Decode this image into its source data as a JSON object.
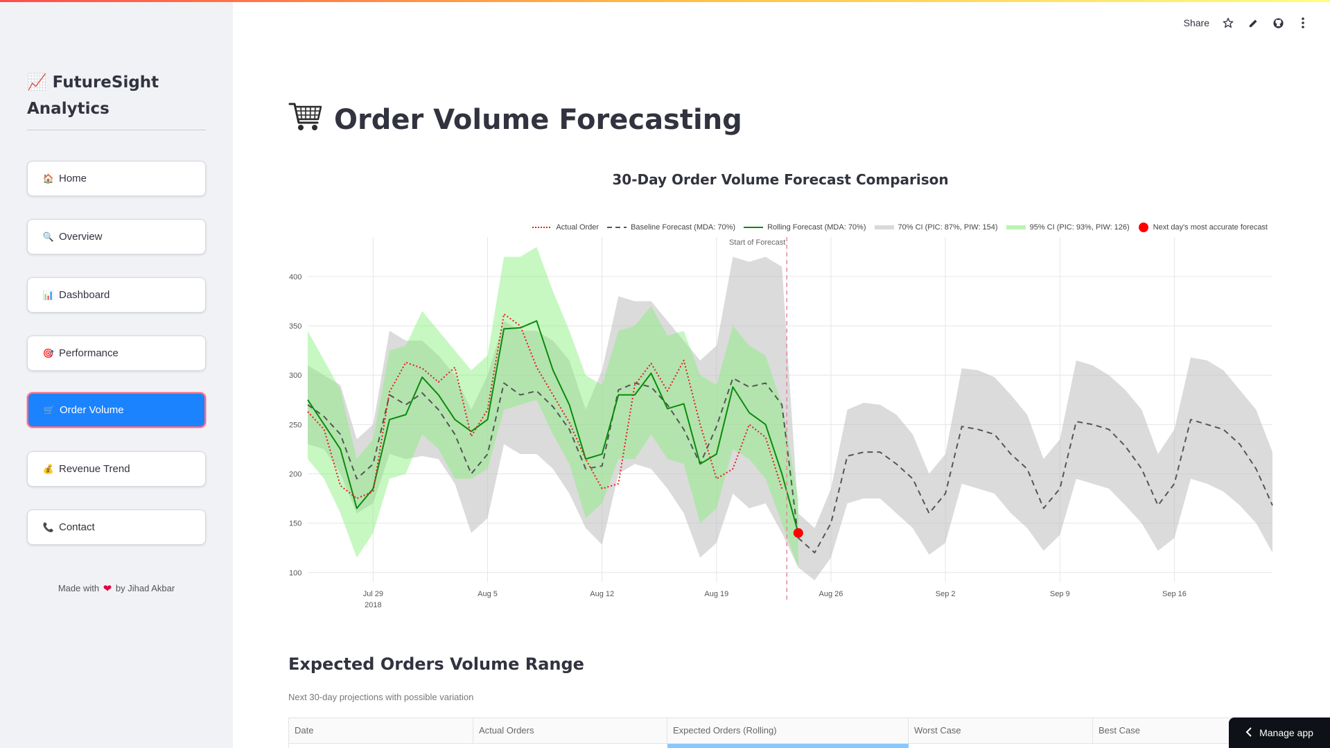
{
  "sidebar": {
    "brand": "📈 FutureSight Analytics",
    "items": [
      {
        "icon": "🏠",
        "label": "Home"
      },
      {
        "icon": "🔍",
        "label": "Overview"
      },
      {
        "icon": "📊",
        "label": "Dashboard"
      },
      {
        "icon": "🎯",
        "label": "Performance"
      },
      {
        "icon": "🛒",
        "label": "Order Volume",
        "active": true
      },
      {
        "icon": "💰",
        "label": "Revenue Trend"
      },
      {
        "icon": "📞",
        "label": "Contact"
      }
    ],
    "footer_prefix": "Made with",
    "footer_suffix": "by Jihad Akbar"
  },
  "header": {
    "share_label": "Share"
  },
  "page": {
    "title": "Order Volume Forecasting",
    "title_icon": "🛒"
  },
  "chart_data": {
    "type": "line",
    "title": "30-Day Order Volume Forecast Comparison",
    "annotation": "Start of Forecast",
    "legend": [
      "Actual Order",
      "Baseline Forecast (MDA: 70%)",
      "Rolling Forecast (MDA: 70%)",
      "70% CI (PIC: 87%, PIW: 154)",
      "95% CI (PIC: 93%, PIW: 126)",
      "Next day's most accurate forecast"
    ],
    "x_ticks": [
      "Jul 29\n2018",
      "Aug 5",
      "Aug 12",
      "Aug 19",
      "Aug 26",
      "Sep 2",
      "Sep 9",
      "Sep 16"
    ],
    "y_ticks": [
      100,
      150,
      200,
      250,
      300,
      350,
      400
    ],
    "ylim": [
      90,
      440
    ],
    "x_start": "2018-07-25",
    "x_end": "2018-09-22",
    "forecast_start": "2018-08-23",
    "series": [
      {
        "name": "Actual Order",
        "dates": [
          "2018-07-25",
          "2018-07-26",
          "2018-07-27",
          "2018-07-28",
          "2018-07-29",
          "2018-07-30",
          "2018-07-31",
          "2018-08-01",
          "2018-08-02",
          "2018-08-03",
          "2018-08-04",
          "2018-08-05",
          "2018-08-06",
          "2018-08-07",
          "2018-08-08",
          "2018-08-09",
          "2018-08-10",
          "2018-08-11",
          "2018-08-12",
          "2018-08-13",
          "2018-08-14",
          "2018-08-15",
          "2018-08-16",
          "2018-08-17",
          "2018-08-18",
          "2018-08-19",
          "2018-08-20",
          "2018-08-21",
          "2018-08-22",
          "2018-08-23"
        ],
        "values": [
          263,
          245,
          188,
          175,
          182,
          283,
          313,
          307,
          293,
          308,
          238,
          265,
          362,
          350,
          308,
          280,
          252,
          215,
          185,
          190,
          290,
          312,
          284,
          315,
          250,
          195,
          205,
          250,
          237,
          185
        ]
      },
      {
        "name": "Baseline Forecast (MDA: 70%)",
        "dates": [
          "2018-07-25",
          "2018-07-26",
          "2018-07-27",
          "2018-07-28",
          "2018-07-29",
          "2018-07-30",
          "2018-07-31",
          "2018-08-01",
          "2018-08-02",
          "2018-08-03",
          "2018-08-04",
          "2018-08-05",
          "2018-08-06",
          "2018-08-07",
          "2018-08-08",
          "2018-08-09",
          "2018-08-10",
          "2018-08-11",
          "2018-08-12",
          "2018-08-13",
          "2018-08-14",
          "2018-08-15",
          "2018-08-16",
          "2018-08-17",
          "2018-08-18",
          "2018-08-19",
          "2018-08-20",
          "2018-08-21",
          "2018-08-22",
          "2018-08-23",
          "2018-08-24",
          "2018-08-25",
          "2018-08-26",
          "2018-08-27",
          "2018-08-28",
          "2018-08-29",
          "2018-08-30",
          "2018-08-31",
          "2018-09-01",
          "2018-09-02",
          "2018-09-03",
          "2018-09-04",
          "2018-09-05",
          "2018-09-06",
          "2018-09-07",
          "2018-09-08",
          "2018-09-09",
          "2018-09-10",
          "2018-09-11",
          "2018-09-12",
          "2018-09-13",
          "2018-09-14",
          "2018-09-15",
          "2018-09-16",
          "2018-09-17",
          "2018-09-18",
          "2018-09-19",
          "2018-09-20",
          "2018-09-21",
          "2018-09-22"
        ],
        "values": [
          270,
          258,
          240,
          195,
          210,
          280,
          270,
          282,
          265,
          240,
          200,
          220,
          292,
          280,
          284,
          268,
          245,
          205,
          208,
          285,
          292,
          288,
          270,
          245,
          210,
          248,
          297,
          288,
          292,
          270,
          135,
          120,
          150,
          218,
          222,
          222,
          210,
          195,
          160,
          180,
          248,
          245,
          240,
          220,
          205,
          165,
          185,
          253,
          250,
          245,
          228,
          205,
          168,
          190,
          255,
          250,
          245,
          230,
          205,
          168
        ]
      },
      {
        "name": "Rolling Forecast (MDA: 70%)",
        "dates": [
          "2018-07-25",
          "2018-07-26",
          "2018-07-27",
          "2018-07-28",
          "2018-07-29",
          "2018-07-30",
          "2018-07-31",
          "2018-08-01",
          "2018-08-02",
          "2018-08-03",
          "2018-08-04",
          "2018-08-05",
          "2018-08-06",
          "2018-08-07",
          "2018-08-08",
          "2018-08-09",
          "2018-08-10",
          "2018-08-11",
          "2018-08-12",
          "2018-08-13",
          "2018-08-14",
          "2018-08-15",
          "2018-08-16",
          "2018-08-17",
          "2018-08-18",
          "2018-08-19",
          "2018-08-20",
          "2018-08-21",
          "2018-08-22",
          "2018-08-23",
          "2018-08-24"
        ],
        "values": [
          275,
          250,
          225,
          165,
          185,
          255,
          260,
          298,
          280,
          255,
          243,
          255,
          347,
          348,
          355,
          305,
          270,
          215,
          220,
          280,
          280,
          302,
          266,
          271,
          210,
          220,
          288,
          262,
          250,
          200,
          140
        ]
      }
    ],
    "next_day_point": {
      "date": "2018-08-24",
      "value": 140
    },
    "ci70_dates": [
      "2018-07-25",
      "2018-07-26",
      "2018-07-27",
      "2018-07-28",
      "2018-07-29",
      "2018-07-30",
      "2018-07-31",
      "2018-08-01",
      "2018-08-02",
      "2018-08-03",
      "2018-08-04",
      "2018-08-05",
      "2018-08-06",
      "2018-08-07",
      "2018-08-08",
      "2018-08-09",
      "2018-08-10",
      "2018-08-11",
      "2018-08-12",
      "2018-08-13",
      "2018-08-14",
      "2018-08-15",
      "2018-08-16",
      "2018-08-17",
      "2018-08-18",
      "2018-08-19",
      "2018-08-20",
      "2018-08-21",
      "2018-08-22",
      "2018-08-23",
      "2018-08-24",
      "2018-08-25",
      "2018-08-26",
      "2018-08-27",
      "2018-08-28",
      "2018-08-29",
      "2018-08-30",
      "2018-08-31",
      "2018-09-01",
      "2018-09-02",
      "2018-09-03",
      "2018-09-04",
      "2018-09-05",
      "2018-09-06",
      "2018-09-07",
      "2018-09-08",
      "2018-09-09",
      "2018-09-10",
      "2018-09-11",
      "2018-09-12",
      "2018-09-13",
      "2018-09-14",
      "2018-09-15",
      "2018-09-16",
      "2018-09-17",
      "2018-09-18",
      "2018-09-19",
      "2018-09-20",
      "2018-09-21",
      "2018-09-22"
    ],
    "ci70_upper": [
      310,
      300,
      290,
      235,
      250,
      345,
      335,
      335,
      320,
      300,
      265,
      300,
      355,
      345,
      345,
      335,
      315,
      265,
      305,
      380,
      375,
      375,
      355,
      335,
      315,
      330,
      420,
      415,
      420,
      410,
      160,
      145,
      185,
      265,
      272,
      270,
      260,
      240,
      200,
      220,
      307,
      305,
      298,
      280,
      260,
      215,
      235,
      315,
      310,
      300,
      285,
      265,
      220,
      245,
      318,
      315,
      305,
      285,
      265,
      222
    ],
    "ci70_lower": [
      230,
      225,
      200,
      160,
      170,
      220,
      215,
      218,
      215,
      190,
      140,
      155,
      230,
      220,
      220,
      205,
      180,
      145,
      128,
      200,
      210,
      205,
      185,
      160,
      115,
      130,
      180,
      165,
      170,
      140,
      105,
      92,
      115,
      170,
      175,
      175,
      160,
      145,
      118,
      130,
      190,
      185,
      180,
      160,
      145,
      122,
      138,
      195,
      190,
      185,
      168,
      150,
      122,
      135,
      195,
      190,
      182,
      168,
      150,
      120
    ],
    "ci95_dates": [
      "2018-07-25",
      "2018-07-26",
      "2018-07-27",
      "2018-07-28",
      "2018-07-29",
      "2018-07-30",
      "2018-07-31",
      "2018-08-01",
      "2018-08-02",
      "2018-08-03",
      "2018-08-04",
      "2018-08-05",
      "2018-08-06",
      "2018-08-07",
      "2018-08-08",
      "2018-08-09",
      "2018-08-10",
      "2018-08-11",
      "2018-08-12",
      "2018-08-13",
      "2018-08-14",
      "2018-08-15",
      "2018-08-16",
      "2018-08-17",
      "2018-08-18",
      "2018-08-19",
      "2018-08-20",
      "2018-08-21",
      "2018-08-22",
      "2018-08-23",
      "2018-08-24"
    ],
    "ci95_upper": [
      345,
      315,
      285,
      215,
      235,
      325,
      330,
      365,
      345,
      325,
      305,
      320,
      420,
      420,
      430,
      385,
      345,
      300,
      290,
      345,
      350,
      370,
      340,
      345,
      300,
      290,
      350,
      330,
      320,
      270,
      175
    ],
    "ci95_lower": [
      215,
      195,
      160,
      115,
      140,
      195,
      200,
      240,
      225,
      195,
      195,
      205,
      265,
      270,
      275,
      240,
      210,
      155,
      170,
      215,
      215,
      240,
      215,
      210,
      150,
      165,
      225,
      215,
      195,
      150,
      105
    ]
  },
  "range_section": {
    "title": "Expected Orders Volume Range",
    "subtitle": "Next 30-day projections with possible variation",
    "columns": [
      "Date",
      "Actual Orders",
      "Expected Orders (Rolling)",
      "Worst Case",
      "Best Case"
    ]
  },
  "manage_app_label": "Manage app",
  "colors": {
    "accent": "#1c83ff",
    "actual": "#e8191d",
    "baseline": "#555555",
    "rolling": "#0a8a0a",
    "ci70": "#d9d9d9",
    "ci95": "#b8f5b0",
    "point": "#ff0000"
  }
}
